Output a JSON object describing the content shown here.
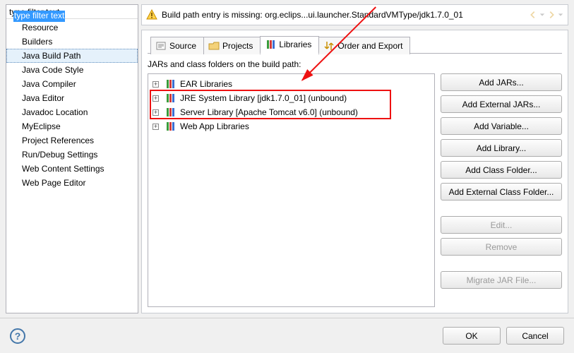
{
  "filter": {
    "value": "type filter text"
  },
  "sidebar_items": [
    "Resource",
    "Builders",
    "Java Build Path",
    "Java Code Style",
    "Java Compiler",
    "Java Editor",
    "Javadoc Location",
    "MyEclipse",
    "Project References",
    "Run/Debug Settings",
    "Web Content Settings",
    "Web Page Editor"
  ],
  "sidebar_selected_index": 2,
  "warning": {
    "text": "Build path entry is missing: org.eclips...ui.launcher.StandardVMType/jdk1.7.0_01"
  },
  "tabs": [
    {
      "label": "Source"
    },
    {
      "label": "Projects"
    },
    {
      "label": "Libraries"
    },
    {
      "label": "Order and Export"
    }
  ],
  "active_tab_index": 2,
  "jars_label": "JARs and class folders on the build path:",
  "libraries": [
    {
      "label": "EAR Libraries"
    },
    {
      "label": "JRE System Library [jdk1.7.0_01] (unbound)"
    },
    {
      "label": "Server Library [Apache Tomcat v6.0] (unbound)"
    },
    {
      "label": "Web App Libraries"
    }
  ],
  "buttons": {
    "add_jars": "Add JARs...",
    "add_ext_jars": "Add External JARs...",
    "add_variable": "Add Variable...",
    "add_library": "Add Library...",
    "add_class_folder": "Add Class Folder...",
    "add_ext_class_folder": "Add External Class Folder...",
    "edit": "Edit...",
    "remove": "Remove",
    "migrate": "Migrate JAR File..."
  },
  "footer": {
    "ok": "OK",
    "cancel": "Cancel"
  }
}
